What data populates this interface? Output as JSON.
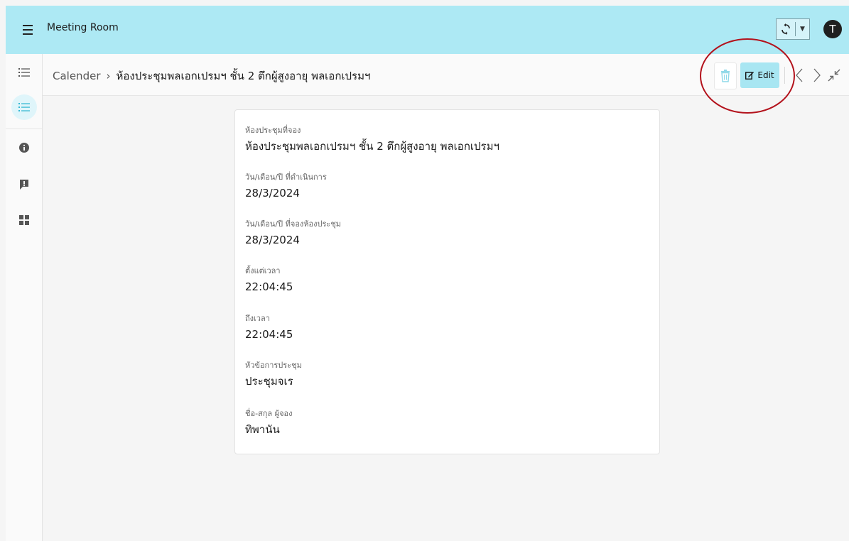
{
  "app": {
    "title": "Meeting Room",
    "user_initial": "T"
  },
  "breadcrumb": {
    "root": "Calender",
    "separator": "›",
    "current": "ห้องประชุมพลเอกเปรมฯ ชั้น 2 ตึกผู้สูงอายุ พลเอกเปรมฯ"
  },
  "toolbar": {
    "edit_label": "Edit"
  },
  "sidebar": {
    "items": [
      {
        "icon": "list-icon",
        "active": false
      },
      {
        "icon": "list-icon",
        "active": true
      },
      {
        "icon": "info-icon",
        "active": false
      },
      {
        "icon": "report-icon",
        "active": false
      },
      {
        "icon": "dashboard-icon",
        "active": false
      }
    ]
  },
  "record": {
    "fields": [
      {
        "label": "ห้องประชุมที่จอง",
        "value": "ห้องประชุมพลเอกเปรมฯ ชั้น 2 ตึกผู้สูงอายุ พลเอกเปรมฯ"
      },
      {
        "label": "วัน/เดือน/ปี ที่ดำเนินการ",
        "value": "28/3/2024"
      },
      {
        "label": "วัน/เดือน/ปี ที่จองห้องประชุม",
        "value": "28/3/2024"
      },
      {
        "label": "ตั้งแต่เวลา",
        "value": "22:04:45"
      },
      {
        "label": "ถึงเวลา",
        "value": "22:04:45"
      },
      {
        "label": "หัวข้อการประชุม",
        "value": "ประชุมจเร"
      },
      {
        "label": "ชื่อ-สกุล ผู้จอง",
        "value": "ทิพานัน"
      }
    ]
  },
  "colors": {
    "topbar": "#ade9f4",
    "accent_button": "#a8e6f2",
    "annotation_ring": "#b3121c"
  }
}
